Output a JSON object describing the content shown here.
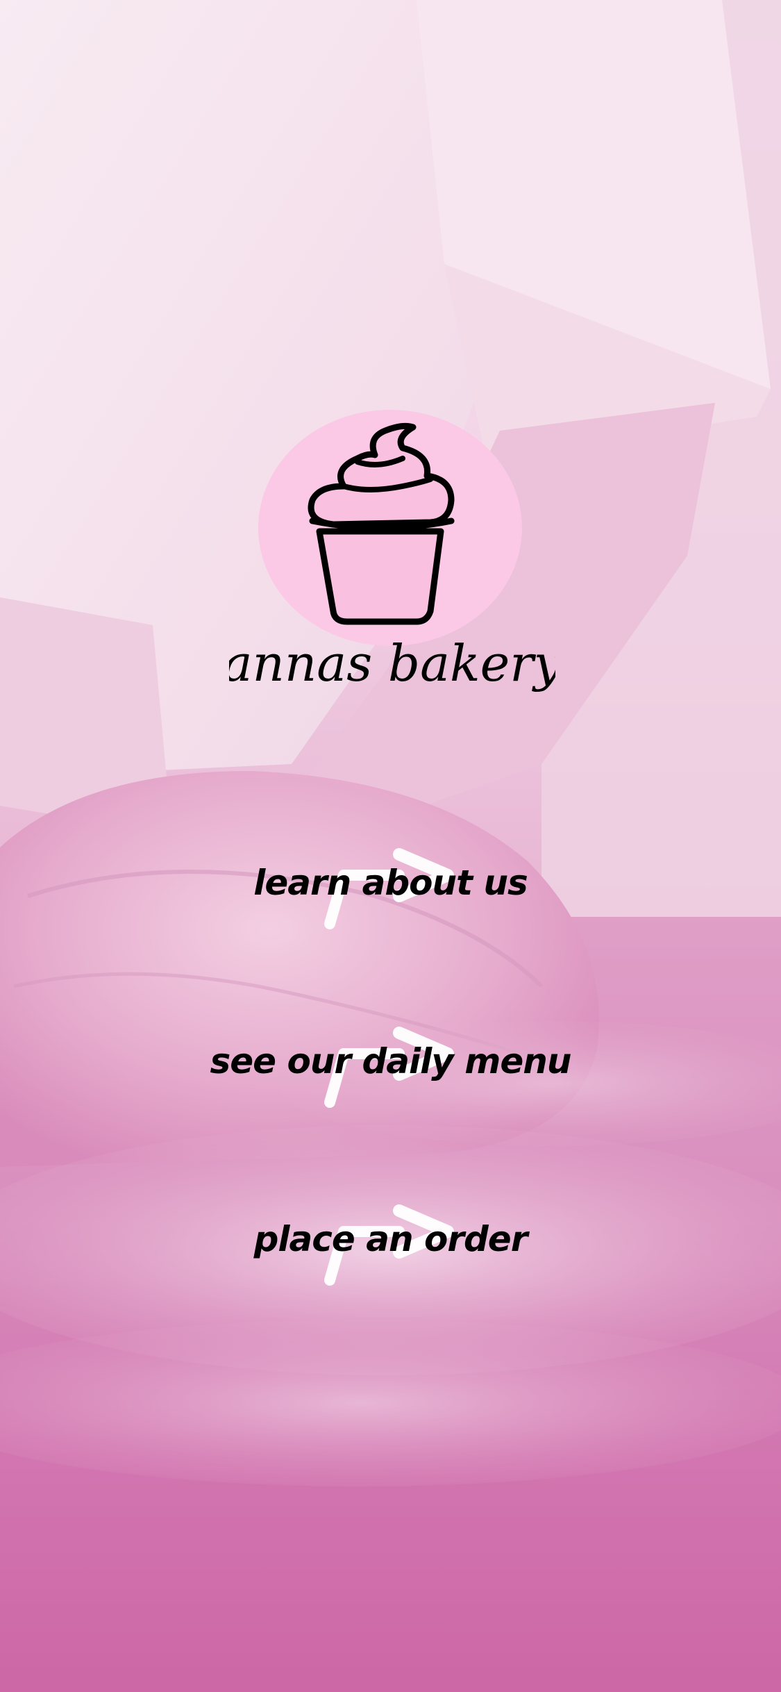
{
  "brand": {
    "name": "annas bakery",
    "logo_icon": "cupcake-icon",
    "logo_circle_color": "#fbc8e6"
  },
  "menu": {
    "items": [
      {
        "label": "learn about us",
        "icon": "chevron-right-icon"
      },
      {
        "label": "see our daily menu",
        "icon": "chevron-right-icon"
      },
      {
        "label": "place an order",
        "icon": "chevron-right-icon"
      }
    ]
  },
  "colors": {
    "background_top": "#f6e2ee",
    "background_mid": "#eab8d4",
    "background_bottom": "#c64f98",
    "text": "#000000",
    "arrow": "#ffffff"
  }
}
